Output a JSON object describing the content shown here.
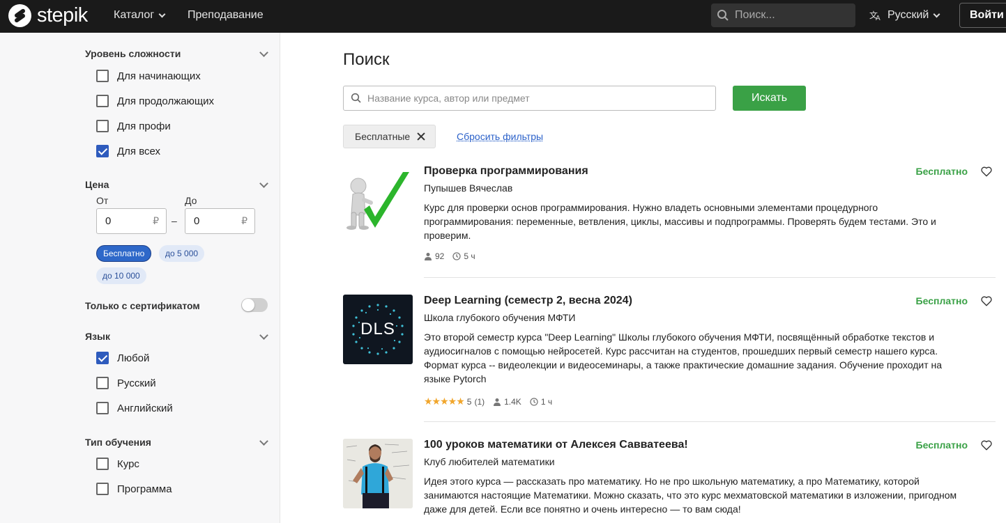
{
  "header": {
    "logo_text": "stepik",
    "catalog_label": "Каталог",
    "teaching_label": "Преподавание",
    "search_placeholder": "Поиск...",
    "language_label": "Русский",
    "login_label": "Войти"
  },
  "sidebar": {
    "difficulty": {
      "title": "Уровень сложности",
      "options": [
        {
          "label": "Для начинающих",
          "checked": false
        },
        {
          "label": "Для продолжающих",
          "checked": false
        },
        {
          "label": "Для профи",
          "checked": false
        },
        {
          "label": "Для всех",
          "checked": true
        }
      ]
    },
    "price": {
      "title": "Цена",
      "from_label": "От",
      "to_label": "До",
      "from_value": "0",
      "to_value": "0",
      "currency": "₽",
      "dash": "–",
      "presets": [
        {
          "label": "Бесплатно",
          "active": true
        },
        {
          "label": "до 5 000",
          "active": false
        },
        {
          "label": "до 10 000",
          "active": false
        }
      ]
    },
    "certificate": {
      "label": "Только с сертификатом",
      "enabled": false
    },
    "language": {
      "title": "Язык",
      "options": [
        {
          "label": "Любой",
          "checked": true
        },
        {
          "label": "Русский",
          "checked": false
        },
        {
          "label": "Английский",
          "checked": false
        }
      ]
    },
    "learning_type": {
      "title": "Тип обучения",
      "options": [
        {
          "label": "Курс",
          "checked": false
        },
        {
          "label": "Программа",
          "checked": false
        }
      ]
    }
  },
  "main": {
    "title": "Поиск",
    "search_placeholder": "Название курса, автор или предмет",
    "search_button": "Искать",
    "active_filter": "Бесплатные",
    "reset_filters": "Сбросить фильтры",
    "courses": [
      {
        "title": "Проверка программирования",
        "author": "Пупышев Вячеслав",
        "description": "Курс для проверки основ программирования. Нужно владеть основными элементами процедурного программирования: переменные, ветвления, циклы, массивы и подпрограммы. Проверять будем тестами. Это и проверим.",
        "price": "Бесплатно",
        "learners": "92",
        "duration": "5 ч"
      },
      {
        "title": "Deep Learning (семестр 2, весна 2024)",
        "author": "Школа глубокого обучения МФТИ",
        "description": "Это второй семестр курса \"Deep Learning\" Школы глубокого обучения МФТИ, посвящённый обработке текстов и аудиосигналов с помощью нейросетей. Курс рассчитан на студентов, прошедших первый семестр нашего курса. Формат курса -- видеолекции и видеосеминары, а также практические домашние задания. Обучение проходит на языке Pytorch",
        "price": "Бесплатно",
        "thumb_text": "DLS",
        "rating": "5",
        "reviews": "(1)",
        "learners": "1.4K",
        "duration": "1 ч"
      },
      {
        "title": "100 уроков математики от Алексея Савватеева!",
        "author": "Клуб любителей математики",
        "description": "Идея этого курса — рассказать про математику. Но не про школьную математику, а про Математику, которой занимаются настоящие Математики. Можно сказать, что это курс мехматовской математики в изложении, пригодном даже для детей. Если все понятно и очень интересно — то вам сюда!",
        "price": "Бесплатно"
      }
    ]
  },
  "colors": {
    "accent_green": "#3aa146",
    "link_blue": "#2b61c9",
    "checkbox_blue": "#2e5bbd",
    "topbar": "#1a1a1a",
    "stars": "#f1a62c"
  }
}
